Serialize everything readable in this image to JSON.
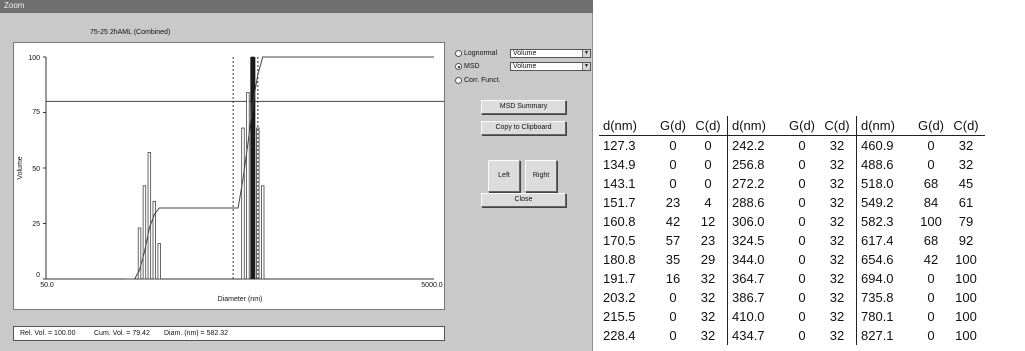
{
  "window": {
    "title": "Zoom"
  },
  "graph": {
    "title": "75-25 2hAML (Combined)",
    "y_ticks": [
      "100",
      "75",
      "50",
      "25",
      "0"
    ],
    "x_min_label": "50.0",
    "x_max_label": "5000.0",
    "xlabel": "Diameter (nm)",
    "ylabel": "Volume"
  },
  "options": {
    "lognormal": {
      "label": "Lognormal",
      "combo": "Volume",
      "selected": false
    },
    "msd": {
      "label": "MSD",
      "combo": "Volume",
      "selected": true
    },
    "corr": {
      "label": "Corr. Funct.",
      "selected": false
    }
  },
  "buttons": {
    "msd_summary": "MSD Summary",
    "copy": "Copy to Clipboard",
    "left": "Left",
    "right": "Right",
    "close": "Close"
  },
  "status": {
    "rel_vol": "Rel. Vol. = 100.00",
    "cum_vol": "Cum. Vol. = 79.42",
    "diam": "Diam. (nm) = 582.32"
  },
  "table": {
    "headers": [
      "d(nm)",
      "G(d)",
      "C(d)",
      "d(nm)",
      "G(d)",
      "C(d)",
      "d(nm)",
      "G(d)",
      "C(d)"
    ],
    "rows": [
      [
        "127.3",
        "0",
        "0",
        "242.2",
        "0",
        "32",
        "460.9",
        "0",
        "32"
      ],
      [
        "134.9",
        "0",
        "0",
        "256.8",
        "0",
        "32",
        "488.6",
        "0",
        "32"
      ],
      [
        "143.1",
        "0",
        "0",
        "272.2",
        "0",
        "32",
        "518.0",
        "68",
        "45"
      ],
      [
        "151.7",
        "23",
        "4",
        "288.6",
        "0",
        "32",
        "549.2",
        "84",
        "61"
      ],
      [
        "160.8",
        "42",
        "12",
        "306.0",
        "0",
        "32",
        "582.3",
        "100",
        "79"
      ],
      [
        "170.5",
        "57",
        "23",
        "324.5",
        "0",
        "32",
        "617.4",
        "68",
        "92"
      ],
      [
        "180.8",
        "35",
        "29",
        "344.0",
        "0",
        "32",
        "654.6",
        "42",
        "100"
      ],
      [
        "191.7",
        "16",
        "32",
        "364.7",
        "0",
        "32",
        "694.0",
        "0",
        "100"
      ],
      [
        "203.2",
        "0",
        "32",
        "386.7",
        "0",
        "32",
        "735.8",
        "0",
        "100"
      ],
      [
        "215.5",
        "0",
        "32",
        "410.0",
        "0",
        "32",
        "780.1",
        "0",
        "100"
      ],
      [
        "228.4",
        "0",
        "32",
        "434.7",
        "0",
        "32",
        "827.1",
        "0",
        "100"
      ]
    ]
  },
  "chart_data": {
    "type": "bar",
    "title": "75-25 2hAML (Combined)",
    "xlabel": "Diameter (nm)",
    "ylabel": "Volume",
    "x_scale": "log",
    "xlim": [
      50.0,
      5000.0
    ],
    "ylim": [
      0,
      100
    ],
    "ytick_values": [
      0,
      25,
      50,
      75,
      100
    ],
    "series": [
      {
        "name": "G(d)",
        "x": [
          151.7,
          160.8,
          170.5,
          180.8,
          191.7,
          518.0,
          549.2,
          582.3,
          617.4,
          654.6
        ],
        "values": [
          23,
          42,
          57,
          35,
          16,
          68,
          84,
          100,
          68,
          42
        ]
      },
      {
        "name": "C(d)",
        "x": [
          127.3,
          134.9,
          143.1,
          151.7,
          160.8,
          170.5,
          180.8,
          191.7,
          203.2,
          242.2,
          306.0,
          410.0,
          488.6,
          518.0,
          549.2,
          582.3,
          617.4,
          654.6,
          694.0,
          827.1,
          5000.0
        ],
        "values": [
          0,
          0,
          0,
          4,
          12,
          23,
          29,
          32,
          32,
          32,
          32,
          32,
          32,
          45,
          61,
          79,
          92,
          100,
          100,
          100,
          100
        ]
      }
    ],
    "reference_line_y": 80,
    "cursor_x": [
      460.9,
      582.3
    ]
  }
}
